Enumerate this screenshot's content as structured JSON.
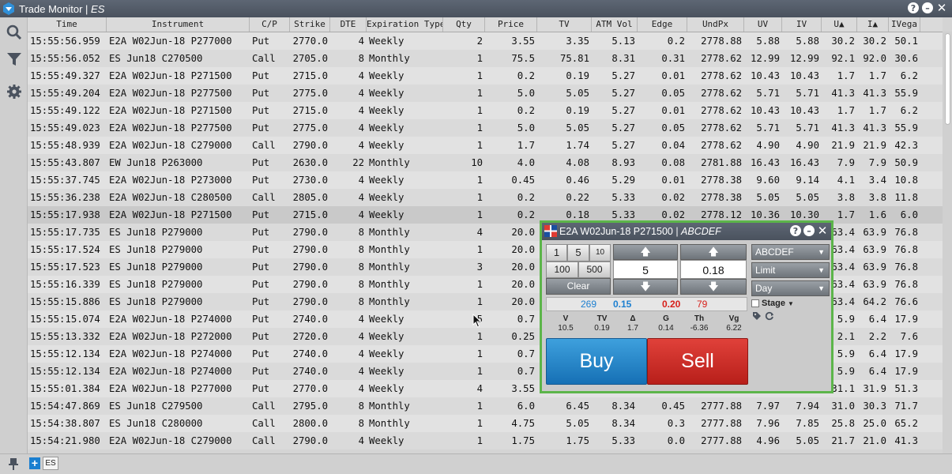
{
  "window": {
    "title_prefix": "Trade Monitor | ",
    "title_symbol": "ES",
    "help_label": "?",
    "minimize_label": "–",
    "close_label": "✕"
  },
  "sidebar": {
    "icons": [
      "search-icon",
      "filter-icon",
      "settings-gear-icon"
    ],
    "pin_icon": "pin-icon"
  },
  "columns": [
    "Time",
    "Instrument",
    "C/P",
    "Strike",
    "DTE",
    "Expiration Type",
    "Qty",
    "Price",
    "TV",
    "ATM Vol",
    "Edge",
    "UndPx",
    "UV",
    "IV",
    "U▲",
    "I▲",
    "IVega"
  ],
  "rows": [
    [
      "15:55:56.959",
      "E2A W02Jun-18 P277000",
      "Put",
      "2770.0",
      "4",
      "Weekly",
      "2",
      "3.55",
      "3.35",
      "5.13",
      "0.2",
      "2778.88",
      "5.88",
      "5.88",
      "30.2",
      "30.2",
      "50.1"
    ],
    [
      "15:55:56.052",
      "ES Jun18 C270500",
      "Call",
      "2705.0",
      "8",
      "Monthly",
      "1",
      "75.5",
      "75.81",
      "8.31",
      "0.31",
      "2778.62",
      "12.99",
      "12.99",
      "92.1",
      "92.0",
      "30.6"
    ],
    [
      "15:55:49.327",
      "E2A W02Jun-18 P271500",
      "Put",
      "2715.0",
      "4",
      "Weekly",
      "1",
      "0.2",
      "0.19",
      "5.27",
      "0.01",
      "2778.62",
      "10.43",
      "10.43",
      "1.7",
      "1.7",
      "6.2"
    ],
    [
      "15:55:49.204",
      "E2A W02Jun-18 P277500",
      "Put",
      "2775.0",
      "4",
      "Weekly",
      "1",
      "5.0",
      "5.05",
      "5.27",
      "0.05",
      "2778.62",
      "5.71",
      "5.71",
      "41.3",
      "41.3",
      "55.9"
    ],
    [
      "15:55:49.122",
      "E2A W02Jun-18 P271500",
      "Put",
      "2715.0",
      "4",
      "Weekly",
      "1",
      "0.2",
      "0.19",
      "5.27",
      "0.01",
      "2778.62",
      "10.43",
      "10.43",
      "1.7",
      "1.7",
      "6.2"
    ],
    [
      "15:55:49.023",
      "E2A W02Jun-18 P277500",
      "Put",
      "2775.0",
      "4",
      "Weekly",
      "1",
      "5.0",
      "5.05",
      "5.27",
      "0.05",
      "2778.62",
      "5.71",
      "5.71",
      "41.3",
      "41.3",
      "55.9"
    ],
    [
      "15:55:48.939",
      "E2A W02Jun-18 C279000",
      "Call",
      "2790.0",
      "4",
      "Weekly",
      "1",
      "1.7",
      "1.74",
      "5.27",
      "0.04",
      "2778.62",
      "4.90",
      "4.90",
      "21.9",
      "21.9",
      "42.3"
    ],
    [
      "15:55:43.807",
      "EW Jun18 P263000",
      "Put",
      "2630.0",
      "22",
      "Monthly",
      "10",
      "4.0",
      "4.08",
      "8.93",
      "0.08",
      "2781.88",
      "16.43",
      "16.43",
      "7.9",
      "7.9",
      "50.9"
    ],
    [
      "15:55:37.745",
      "E2A W02Jun-18 P273000",
      "Put",
      "2730.0",
      "4",
      "Weekly",
      "1",
      "0.45",
      "0.46",
      "5.29",
      "0.01",
      "2778.38",
      "9.60",
      "9.14",
      "4.1",
      "3.4",
      "10.8"
    ],
    [
      "15:55:36.238",
      "E2A W02Jun-18 C280500",
      "Call",
      "2805.0",
      "4",
      "Weekly",
      "1",
      "0.2",
      "0.22",
      "5.33",
      "0.02",
      "2778.38",
      "5.05",
      "5.05",
      "3.8",
      "3.8",
      "11.8"
    ],
    [
      "15:55:17.938",
      "E2A W02Jun-18 P271500",
      "Put",
      "2715.0",
      "4",
      "Weekly",
      "1",
      "0.2",
      "0.18",
      "5.33",
      "0.02",
      "2778.12",
      "10.36",
      "10.30",
      "1.7",
      "1.6",
      "6.0"
    ],
    [
      "15:55:17.735",
      "ES Jun18 P279000",
      "Put",
      "2790.0",
      "8",
      "Monthly",
      "4",
      "20.0",
      "",
      "",
      "",
      "",
      "",
      "",
      "63.4",
      "63.9",
      "76.8"
    ],
    [
      "15:55:17.524",
      "ES Jun18 P279000",
      "Put",
      "2790.0",
      "8",
      "Monthly",
      "1",
      "20.0",
      "",
      "",
      "",
      "",
      "",
      "",
      "63.4",
      "63.9",
      "76.8"
    ],
    [
      "15:55:17.523",
      "ES Jun18 P279000",
      "Put",
      "2790.0",
      "8",
      "Monthly",
      "3",
      "20.0",
      "",
      "",
      "",
      "",
      "",
      "",
      "63.4",
      "63.9",
      "76.8"
    ],
    [
      "15:55:16.339",
      "ES Jun18 P279000",
      "Put",
      "2790.0",
      "8",
      "Monthly",
      "1",
      "20.0",
      "",
      "",
      "",
      "",
      "",
      "",
      "63.4",
      "63.9",
      "76.8"
    ],
    [
      "15:55:15.886",
      "ES Jun18 P279000",
      "Put",
      "2790.0",
      "8",
      "Monthly",
      "1",
      "20.0",
      "",
      "",
      "",
      "",
      "",
      "",
      "63.4",
      "64.2",
      "76.6"
    ],
    [
      "15:55:15.074",
      "E2A W02Jun-18 P274000",
      "Put",
      "2740.0",
      "4",
      "Weekly",
      "5",
      "0.7",
      "",
      "",
      "",
      "",
      "",
      "",
      "5.9",
      "6.4",
      "17.9"
    ],
    [
      "15:55:13.332",
      "E2A W02Jun-18 P272000",
      "Put",
      "2720.0",
      "4",
      "Weekly",
      "1",
      "0.25",
      "",
      "",
      "",
      "",
      "",
      "",
      "2.1",
      "2.2",
      "7.6"
    ],
    [
      "15:55:12.134",
      "E2A W02Jun-18 P274000",
      "Put",
      "2740.0",
      "4",
      "Weekly",
      "1",
      "0.7",
      "",
      "",
      "",
      "",
      "",
      "",
      "5.9",
      "6.4",
      "17.9"
    ],
    [
      "15:55:12.134",
      "E2A W02Jun-18 P274000",
      "Put",
      "2740.0",
      "4",
      "Weekly",
      "1",
      "0.7",
      "",
      "",
      "",
      "",
      "",
      "",
      "5.9",
      "6.4",
      "17.9"
    ],
    [
      "15:55:01.384",
      "E2A W02Jun-18 P277000",
      "Put",
      "2770.0",
      "4",
      "Weekly",
      "4",
      "3.55",
      "",
      "",
      "",
      "",
      "",
      "",
      "31.1",
      "31.9",
      "51.3"
    ],
    [
      "15:54:47.869",
      "ES Jun18 C279500",
      "Call",
      "2795.0",
      "8",
      "Monthly",
      "1",
      "6.0",
      "6.45",
      "8.34",
      "0.45",
      "2777.88",
      "7.97",
      "7.94",
      "31.0",
      "30.3",
      "71.7"
    ],
    [
      "15:54:38.807",
      "ES Jun18 C280000",
      "Call",
      "2800.0",
      "8",
      "Monthly",
      "1",
      "4.75",
      "5.05",
      "8.34",
      "0.3",
      "2777.88",
      "7.96",
      "7.85",
      "25.8",
      "25.0",
      "65.2"
    ],
    [
      "15:54:21.980",
      "E2A W02Jun-18 C279000",
      "Call",
      "2790.0",
      "4",
      "Weekly",
      "1",
      "1.75",
      "1.75",
      "5.33",
      "0.0",
      "2777.88",
      "4.96",
      "5.05",
      "21.7",
      "21.0",
      "41.3"
    ]
  ],
  "bottom": {
    "add_tab_label": "+",
    "tab_label": "ES"
  },
  "ticket": {
    "title_instrument": "E2A W02Jun-18 P271500 | ",
    "title_account": "ABCDEF",
    "qty_buttons": [
      "1",
      "5",
      "10",
      "100",
      "500"
    ],
    "clear_label": "Clear",
    "up_arrow": "🡅",
    "down_arrow": "🡇",
    "qty_value": "5",
    "price_value": "0.18",
    "account_select": "ABCDEF",
    "order_type_select": "Limit",
    "tif_select": "Day",
    "bid_size": "269",
    "bid_price": "0.15",
    "ask_price": "0.20",
    "ask_size": "79",
    "stage_label": "Stage",
    "greek_labels": [
      "V",
      "TV",
      "Δ",
      "G",
      "Th",
      "Vg"
    ],
    "greek_values": [
      "10.5",
      "0.19",
      "1.7",
      "0.14",
      "-6.36",
      "6.22"
    ],
    "buy_label": "Buy",
    "sell_label": "Sell",
    "colors": {
      "bid": "#1c7fd0",
      "ask": "#d7201a",
      "border": "#5cb54a"
    }
  }
}
